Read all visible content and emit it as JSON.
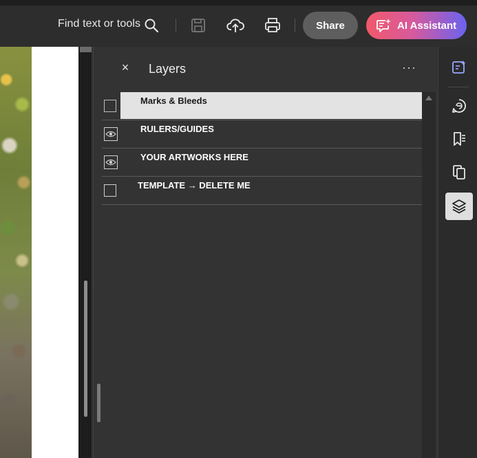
{
  "toolbar": {
    "find_label": "Find text or tools",
    "share_label": "Share",
    "ai_label": "AI Assistant",
    "icons": [
      "search-icon",
      "save-icon",
      "cloud-upload-icon",
      "print-icon",
      "ai-assistant-icon"
    ]
  },
  "layers_panel": {
    "title": "Layers",
    "close_glyph": "×",
    "more_glyph": "···",
    "layers": [
      {
        "name": "Marks & Bleeds",
        "visible": false,
        "selected": true
      },
      {
        "name": "RULERS/GUIDES",
        "visible": true,
        "selected": false
      },
      {
        "name": "YOUR ARTWORKS HERE",
        "visible": true,
        "selected": false
      },
      {
        "name": "TEMPLATE → DELETE ME",
        "visible": false,
        "selected": false
      }
    ]
  },
  "right_rail": {
    "icons": [
      "comment-edit-icon",
      "ai-summary-icon",
      "bookmarks-icon",
      "pages-icon",
      "layers-icon"
    ],
    "active": "layers-icon"
  },
  "colors": {
    "ai_gradient": [
      "#f0596a",
      "#6a63f0"
    ],
    "selection": "#e3e3e3",
    "panel_bg": "#333333"
  }
}
